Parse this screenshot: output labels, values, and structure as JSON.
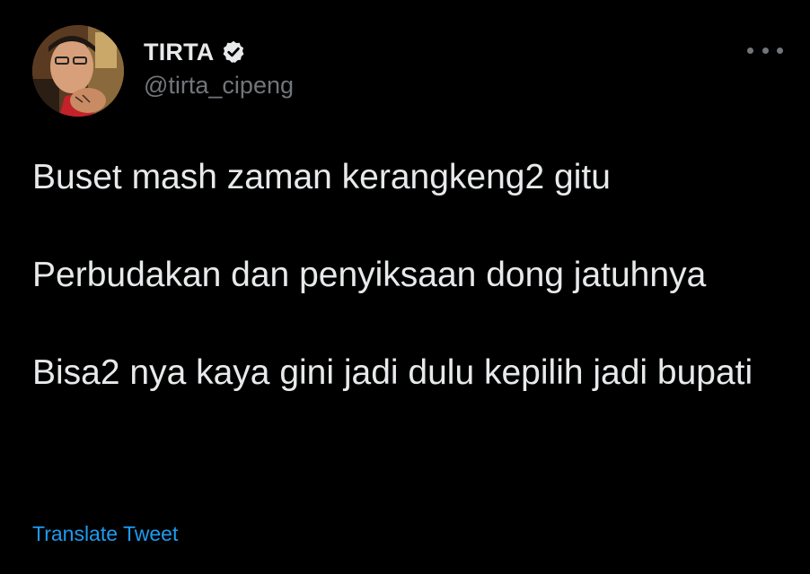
{
  "author": {
    "display_name": "TIRTA",
    "handle": "@tirta_cipeng",
    "verified": true
  },
  "tweet": {
    "paragraphs": [
      "Buset mash zaman kerangkeng2 gitu",
      "Perbudakan dan penyiksaan dong jatuhnya",
      "Bisa2 nya kaya gini jadi dulu kepilih jadi bupati"
    ],
    "translate_label": "Translate Tweet"
  },
  "icons": {
    "verified": "verified-badge-icon",
    "more": "more-options-icon"
  },
  "colors": {
    "background": "#000000",
    "primary_text": "#e7e9ea",
    "secondary_text": "#71767b",
    "link": "#1d9bf0"
  }
}
